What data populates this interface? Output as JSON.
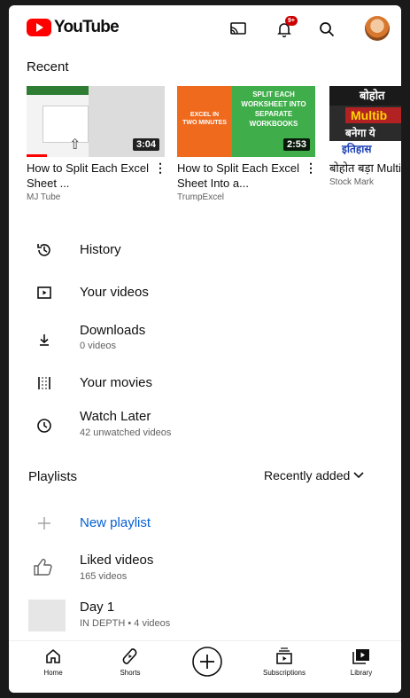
{
  "header": {
    "logo_text": "YouTube",
    "notification_badge": "9+",
    "icons": [
      "cast-icon",
      "bell-icon",
      "search-icon",
      "avatar"
    ]
  },
  "recent": {
    "title": "Recent",
    "videos": [
      {
        "title": "How to Split Each Excel Sheet ...",
        "channel": "MJ Tube",
        "duration": "3:04",
        "progress": 0.15
      },
      {
        "title": "How to Split Each Excel Sheet Into a...",
        "channel": "TrumpExcel",
        "duration": "2:53",
        "thumb_text_left": "EXCEL IN TWO MINUTES",
        "thumb_text_right": "SPLIT EACH WORKSHEET INTO SEPARATE WORKBOOKS",
        "progress": 0.0
      },
      {
        "title": "बोहोत बड़ा Multibagger",
        "channel": "Stock Mark",
        "thumb_text_top": "बोहोत",
        "thumb_text_mid": "Multib",
        "thumb_text_bottom": "बनेगा ये",
        "thumb_text_foot": "इतिहास",
        "progress": 0.0
      }
    ]
  },
  "menu": [
    {
      "label": "History",
      "icon": "history-icon"
    },
    {
      "label": "Your videos",
      "icon": "play-box-icon"
    },
    {
      "label": "Downloads",
      "sub": "0 videos",
      "icon": "download-icon"
    },
    {
      "label": "Your movies",
      "icon": "film-icon"
    },
    {
      "label": "Watch Later",
      "sub": "42 unwatched videos",
      "icon": "clock-icon"
    }
  ],
  "playlists": {
    "title": "Playlists",
    "sort_label": "Recently added",
    "new_playlist": "New playlist",
    "items": [
      {
        "label": "Liked videos",
        "sub": "165 videos",
        "icon": "thumbs-up-icon"
      },
      {
        "label": "Day 1",
        "sub": "IN DEPTH • 4 videos",
        "icon": "playlist-thumb"
      }
    ]
  },
  "bottom_nav": [
    {
      "label": "Home",
      "icon": "home-icon"
    },
    {
      "label": "Shorts",
      "icon": "shorts-icon"
    },
    {
      "label": "",
      "icon": "create-plus-icon"
    },
    {
      "label": "Subscriptions",
      "icon": "subscriptions-icon"
    },
    {
      "label": "Library",
      "icon": "library-icon"
    }
  ],
  "colors": {
    "brand_red": "#ff0000",
    "text": "#0f0f0f",
    "secondary": "#606060",
    "link_blue": "#065fd4"
  }
}
